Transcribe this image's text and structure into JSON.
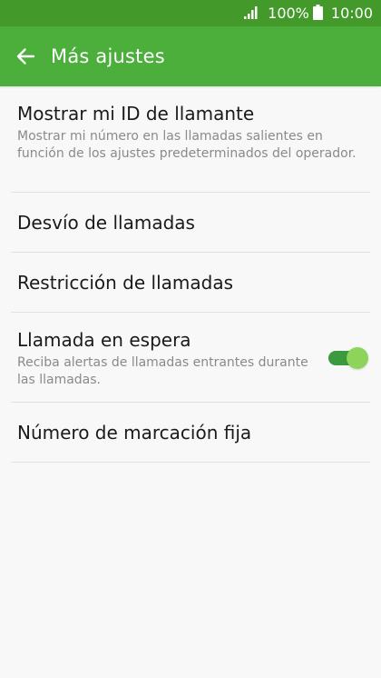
{
  "status_bar": {
    "battery": "100%",
    "time": "10:00"
  },
  "app_bar": {
    "title": "Más ajustes"
  },
  "settings": {
    "caller_id": {
      "title": "Mostrar mi ID de llamante",
      "summary": "Mostrar mi número en las llamadas salientes en función de los ajustes predeterminados del operador."
    },
    "call_forwarding": {
      "title": "Desvío de llamadas"
    },
    "call_barring": {
      "title": "Restricción de llamadas"
    },
    "call_waiting": {
      "title": "Llamada en espera",
      "summary": "Reciba alertas de llamadas entrantes durante las llamadas.",
      "enabled": true
    },
    "fixed_dialing": {
      "title": "Número de marcación fija"
    }
  },
  "colors": {
    "status_bar": "#439a2b",
    "app_bar": "#4caf3c",
    "toggle_track": "#3a9a3d",
    "toggle_thumb": "#8ed45b"
  }
}
